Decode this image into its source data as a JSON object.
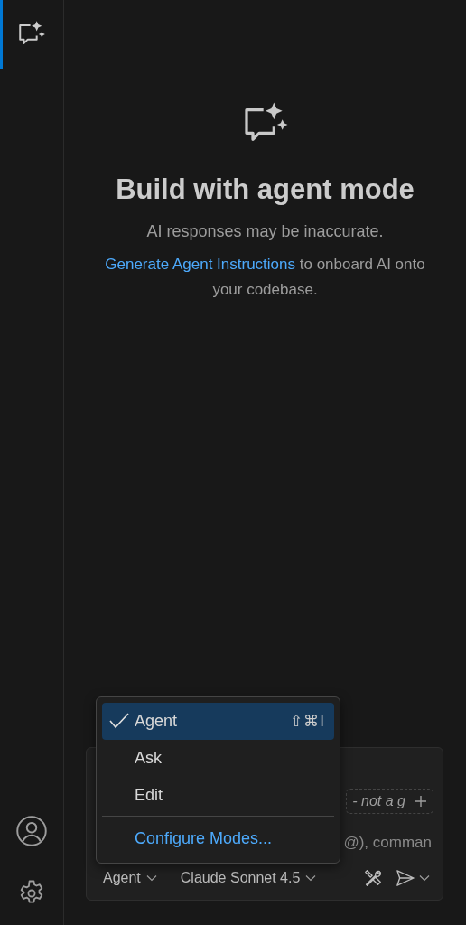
{
  "activity_bar": {
    "top_items": [
      {
        "kind": "chat",
        "selected": true
      }
    ],
    "bottom_items": [
      {
        "kind": "account"
      },
      {
        "kind": "settings"
      }
    ]
  },
  "welcome": {
    "title": "Build with agent mode",
    "subtitle": "AI responses may be inaccurate.",
    "link": "Generate Agent Instructions",
    "rest": " to onboard AI onto your codebase."
  },
  "input": {
    "chip_text": "- not a g",
    "placeholder_fragment": "@), comman",
    "mode_picker": "Agent",
    "model_picker": "Claude Sonnet 4.5"
  },
  "mode_menu": {
    "items": [
      {
        "kind": "mode",
        "label": "Agent",
        "selected": true,
        "shortcut": "⇧⌘I"
      },
      {
        "kind": "mode",
        "label": "Ask",
        "selected": false
      },
      {
        "kind": "mode",
        "label": "Edit",
        "selected": false
      },
      {
        "kind": "action",
        "label": "Configure Modes..."
      }
    ]
  }
}
